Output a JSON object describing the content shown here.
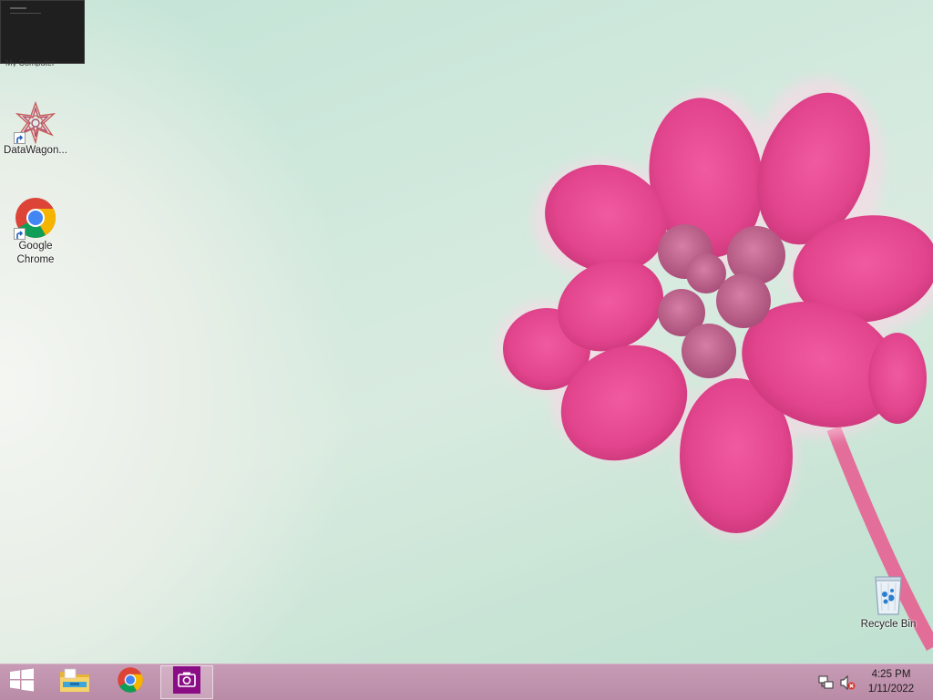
{
  "preview_window": {
    "caption": "",
    "under_text": "My Computer"
  },
  "desktop_icons": [
    {
      "name": "datawagon",
      "label": "DataWagon...",
      "icon": "datawagon-star-icon"
    },
    {
      "name": "chrome",
      "label": "Google\nChrome",
      "icon": "chrome-icon"
    },
    {
      "name": "recycle-bin",
      "label": "Recycle Bin",
      "icon": "recycle-bin-icon"
    }
  ],
  "taskbar": {
    "start_icon": "windows-logo-icon",
    "pinned": [
      {
        "name": "file-explorer",
        "icon": "folder-icon"
      },
      {
        "name": "chrome",
        "icon": "chrome-icon"
      },
      {
        "name": "camera-app",
        "icon": "camera-icon",
        "active": true
      }
    ],
    "tray": {
      "network_icon": "network-icon",
      "volume_icon": "volume-muted-icon"
    },
    "clock": {
      "time": "4:25 PM",
      "date": "1/11/2022"
    }
  },
  "colors": {
    "taskbar": "#bd8fab",
    "active_app": "#8a0d86",
    "flower": "#e0468e"
  }
}
